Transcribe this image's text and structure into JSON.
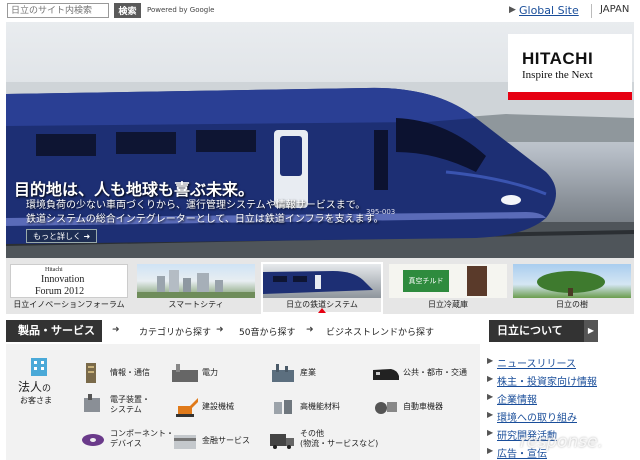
{
  "topbar": {
    "search_placeholder": "日立のサイト内検索",
    "search_button": "検索",
    "powered_by": "Powered by Google",
    "global_site": "Global Site",
    "region": "JAPAN"
  },
  "logo": {
    "name": "HITACHI",
    "tagline": "Inspire the Next"
  },
  "hero": {
    "headline": "目的地は、人も地球も喜ぶ未来。",
    "sub_line1": "環境負荷の少ない車両づくりから、運行管理システムや情報サービスまで。",
    "sub_line2": "鉄道システムの総合インテグレーターとして、日立は鉄道インフラを支えます。",
    "more_button": "もっと詳しく",
    "train_number": "395-003"
  },
  "thumbnails": [
    {
      "label": "日立イノベーションフォーラム",
      "img_line1": "Hitachi",
      "img_line2": "Innovation",
      "img_line3": "Forum 2012"
    },
    {
      "label": "スマートシティ"
    },
    {
      "label": "日立の鉄道システム",
      "active": true
    },
    {
      "label": "日立冷蔵庫",
      "img_text": "真空チルド"
    },
    {
      "label": "日立の樹"
    }
  ],
  "categories": {
    "title": "製品・サービス",
    "links": [
      "カテゴリから探す",
      "50音から探す",
      "ビジネストレンドから探す"
    ]
  },
  "products": {
    "segment_label": "法人",
    "segment_suffix": "の",
    "segment_sub": "お客さま",
    "items": [
      {
        "label": "情報・通信",
        "icon": "server-icon"
      },
      {
        "label": "電力",
        "icon": "power-plant-icon"
      },
      {
        "label": "産業",
        "icon": "factory-icon"
      },
      {
        "label": "公共・都市・交通",
        "icon": "train-icon"
      },
      {
        "label_1": "電子装置・",
        "label_2": "システム",
        "icon": "microscope-icon"
      },
      {
        "label": "建設機械",
        "icon": "excavator-icon"
      },
      {
        "label": "高機能材料",
        "icon": "materials-icon"
      },
      {
        "label": "自動車機器",
        "icon": "car-parts-icon"
      },
      {
        "label_1": "コンポーネント・",
        "label_2": "デバイス",
        "icon": "disk-icon"
      },
      {
        "label": "金融サービス",
        "icon": "card-icon"
      },
      {
        "label_1": "その他",
        "label_2": "(物流・サービスなど)",
        "icon": "truck-icon"
      }
    ]
  },
  "about": {
    "title": "日立について",
    "items": [
      "ニュースリリース",
      "株主・投資家向け情報",
      "企業情報",
      "環境への取り組み",
      "研究開発活動",
      "広告・宣伝"
    ]
  },
  "watermark": "response."
}
